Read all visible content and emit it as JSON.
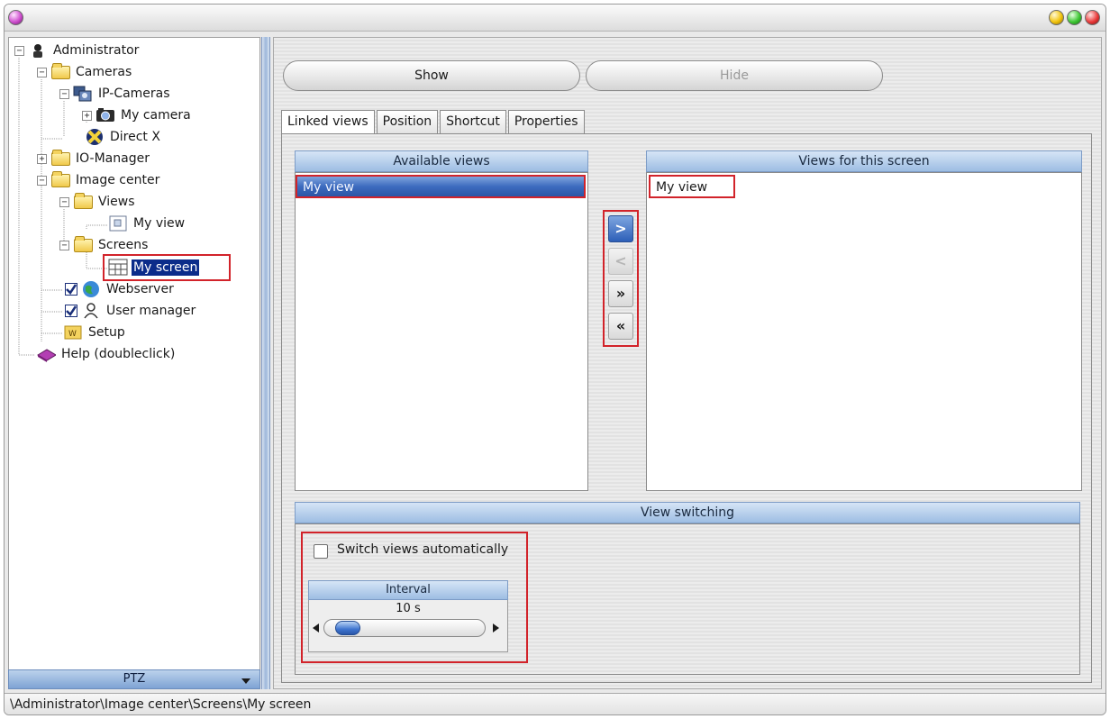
{
  "tree": {
    "items": [
      {
        "label": "Administrator",
        "icon": "admin-icon",
        "expander": "-"
      },
      {
        "label": "Cameras",
        "icon": "folder-open-icon",
        "expander": "-"
      },
      {
        "label": "IP-Cameras",
        "icon": "ip-cameras-icon",
        "expander": "-"
      },
      {
        "label": "My camera",
        "icon": "camera-icon",
        "expander": "+"
      },
      {
        "label": "Direct X",
        "icon": "directx-icon",
        "expander": ""
      },
      {
        "label": "IO-Manager",
        "icon": "folder-icon",
        "expander": "+"
      },
      {
        "label": "Image center",
        "icon": "folder-open-icon",
        "expander": "-"
      },
      {
        "label": "Views",
        "icon": "folder-open-icon",
        "expander": "-"
      },
      {
        "label": "My view",
        "icon": "view-icon",
        "expander": ""
      },
      {
        "label": "Screens",
        "icon": "folder-open-icon",
        "expander": "-"
      },
      {
        "label": "My screen",
        "icon": "screen-icon",
        "expander": "",
        "selected": true
      },
      {
        "label": "Webserver",
        "icon": "globe-icon",
        "expander": "",
        "checked": true
      },
      {
        "label": "User manager",
        "icon": "user-manager-icon",
        "expander": "",
        "checked": true
      },
      {
        "label": "Setup",
        "icon": "setup-icon",
        "expander": ""
      },
      {
        "label": "Help (doubleclick)",
        "icon": "help-book-icon",
        "expander": ""
      }
    ]
  },
  "ptz": {
    "label": "PTZ"
  },
  "toolbar": {
    "show_label": "Show",
    "hide_label": "Hide"
  },
  "tabs": [
    "Linked views",
    "Position",
    "Shortcut",
    "Properties"
  ],
  "linked_views": {
    "available_header": "Available views",
    "available_items": [
      "My view"
    ],
    "screen_header": "Views for this screen",
    "screen_items": [
      "My view"
    ],
    "move_buttons": {
      "add": ">",
      "remove": "<",
      "add_all": "»",
      "remove_all": "«"
    }
  },
  "view_switching": {
    "header": "View switching",
    "checkbox_label": "Switch views automatically",
    "checked": false,
    "interval_header": "Interval",
    "interval_value": "10 s"
  },
  "status": {
    "path": "\\Administrator\\Image center\\Screens\\My screen"
  },
  "colors": {
    "selection": "#0b2c8a",
    "highlight_box": "#d2232a",
    "header_blue": "#9dbde3"
  }
}
